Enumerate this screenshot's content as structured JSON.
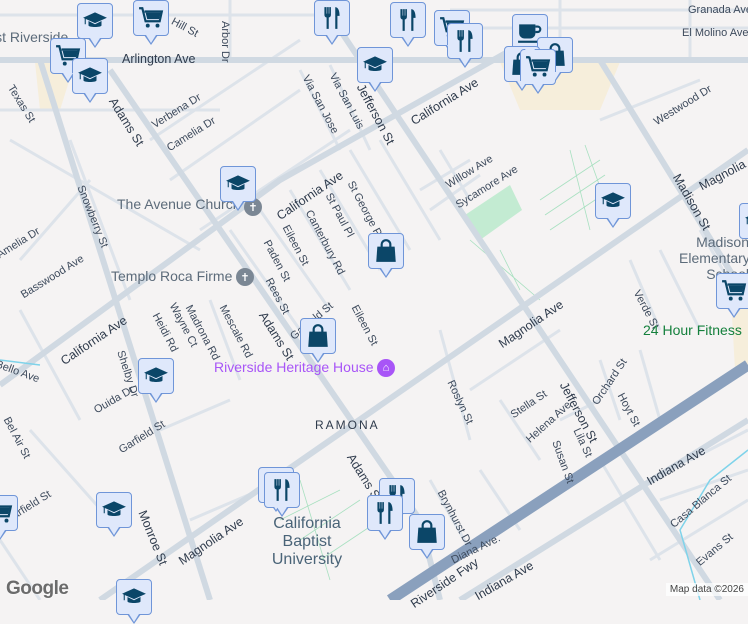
{
  "map": {
    "streets": [
      "Arlington Ave",
      "California Ave",
      "California Ave",
      "California Ave",
      "Adams St",
      "Adams St",
      "Adams St",
      "Jefferson St",
      "Jefferson St",
      "Madison St",
      "Magnolia Ave",
      "Magnolia Ave",
      "Magnolia Ave",
      "Monroe St",
      "Indiana Ave",
      "Indiana Ave",
      "Riverside Fwy",
      "Texas St",
      "Verbena Dr",
      "Camelia Dr",
      "Snowberry St",
      "Basswood Ave",
      "Camelia Dr",
      "Via San Jose",
      "Via San Luis",
      "St George Pl",
      "St Paul Pl",
      "Canterbury Rd",
      "Eileen St",
      "Paden St",
      "Rees St",
      "Garfield St",
      "Eileen St",
      "Mescale Rd",
      "Madrona Rd",
      "Wayne Ct",
      "Heidi Rd",
      "Shelby Dr",
      "Ouida Dr",
      "Garfield St",
      "Bel Air St",
      "Garfield St",
      "Willow Ave",
      "Sycamore Ave",
      "Westwood Dr",
      "Granada Ave",
      "El Molino Ave",
      "Arbor Dr",
      "Roslyn St",
      "Stella St",
      "Helena Ave",
      "Susan St",
      "Lila St",
      "Orchard St",
      "Hoyt St",
      "Verde St",
      "Brynhurst Dr",
      "Diana Ave.",
      "Casa Blanca St",
      "Evans St",
      "Bello Ave",
      "Hill St",
      "Amelia Dr"
    ],
    "places": {
      "avenue_church": "The Avenue Church",
      "templo": "Templo Roca Firme",
      "heritage_house": "Riverside Heritage House",
      "madison_school": "Madison Elementary School",
      "fitness": "24 Hour Fitness",
      "cbu": "California Baptist University",
      "ramona": "RAMONA",
      "east_riverside": "East Riverside"
    },
    "colors": {
      "road": "#d5dde5",
      "freeway": "#8aa0bd",
      "pin_bg": "#dfe8fb",
      "pin_icon": "#0b4668",
      "park": "#c3ebd2",
      "commercial": "#f6eedb",
      "water": "#7fd3ea",
      "heritage": "#a855f7",
      "fitness": "#15803d"
    },
    "attribution": "Map data ©2026",
    "logo": "Google"
  }
}
